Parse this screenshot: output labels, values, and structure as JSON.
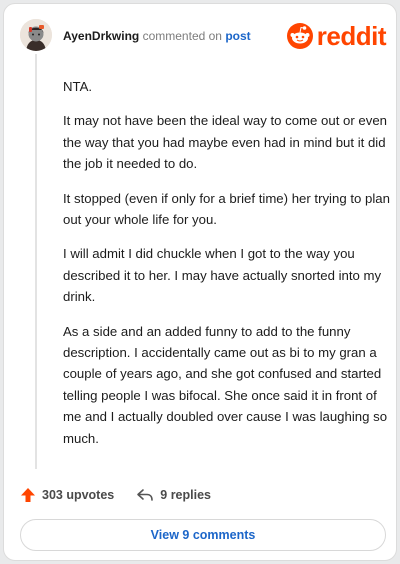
{
  "header": {
    "username": "AyenDrkwing",
    "action_text": "commented on",
    "target_text": "post",
    "logo_text": "reddit"
  },
  "comment": {
    "paragraphs": [
      "NTA.",
      "It may not have been the ideal way to come out or even the way that you had maybe even had in mind but it did the job it needed to do.",
      "It stopped (even if only for a brief time) her trying to plan out your whole life for you.",
      "I will admit I did chuckle when I got to the way you described it to her. I may have actually snorted into my drink.",
      "As a side and an added funny to add to the funny description. I accidentally came out as bi to my gran a couple of years ago, and she got confused and started telling people I was bifocal. She once said it in front of me and I actually doubled over cause I was laughing so much."
    ]
  },
  "actions": {
    "upvotes": "303 upvotes",
    "replies": "9 replies"
  },
  "view_comments": "View 9 comments",
  "colors": {
    "reddit_orange": "#ff4500",
    "link_blue": "#1c66c9",
    "text": "#1c1c1c",
    "muted": "#7c7c7c"
  },
  "icons": [
    "avatar",
    "reddit-logo-icon",
    "upvote-arrow-icon",
    "reply-icon"
  ]
}
